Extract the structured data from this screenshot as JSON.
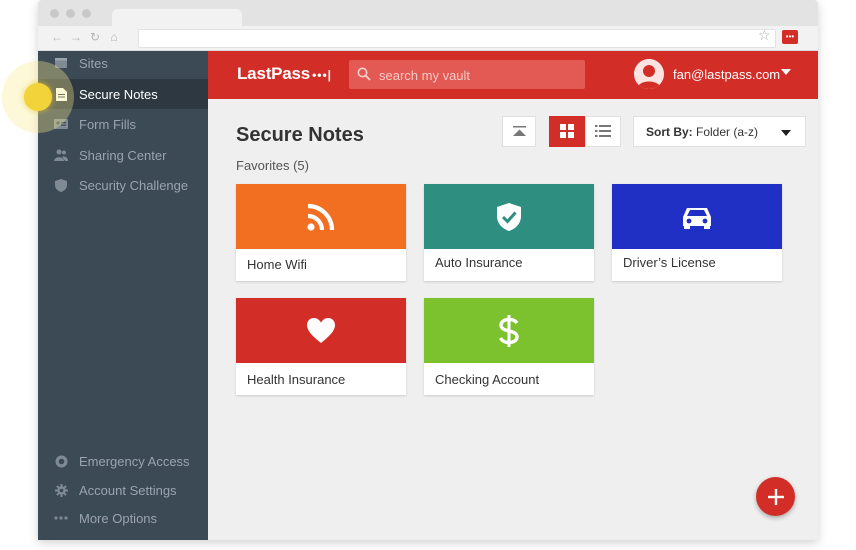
{
  "app": {
    "logo_text": "LastPass",
    "logo_dots": "•••|"
  },
  "browser": {
    "ext_icon": "•••"
  },
  "search": {
    "placeholder": "search my vault"
  },
  "user": {
    "email": "fan@lastpass.com"
  },
  "sidebar": {
    "items": [
      {
        "label": "Sites",
        "icon": "sites-icon"
      },
      {
        "label": "Secure Notes",
        "icon": "note-icon"
      },
      {
        "label": "Form Fills",
        "icon": "id-card-icon"
      },
      {
        "label": "Sharing Center",
        "icon": "people-icon"
      },
      {
        "label": "Security Challenge",
        "icon": "shield-icon"
      }
    ],
    "bottom_items": [
      {
        "label": "Emergency Access",
        "icon": "lifebuoy-icon"
      },
      {
        "label": "Account Settings",
        "icon": "gear-icon"
      },
      {
        "label": "More Options",
        "icon": "more-dots-icon"
      }
    ]
  },
  "main": {
    "title": "Secure Notes",
    "favorites_label": "Favorites (5)",
    "sort_label": "Sort By:",
    "sort_value": "Folder (a-z)"
  },
  "cards": [
    {
      "label": "Home Wifi",
      "color": "#f26f21",
      "icon": "wifi-icon"
    },
    {
      "label": "Auto Insurance",
      "color": "#2e8f81",
      "icon": "shield-check-icon"
    },
    {
      "label": "Driver’s License",
      "color": "#2130c4",
      "icon": "car-icon"
    },
    {
      "label": "Health Insurance",
      "color": "#d32d27",
      "icon": "heart-icon"
    },
    {
      "label": "Checking Account",
      "color": "#7cc22f",
      "icon": "dollar-icon"
    }
  ],
  "colors": {
    "brand_red": "#d32d27",
    "sidebar_bg": "#3c4a56",
    "content_bg": "#efefef"
  }
}
